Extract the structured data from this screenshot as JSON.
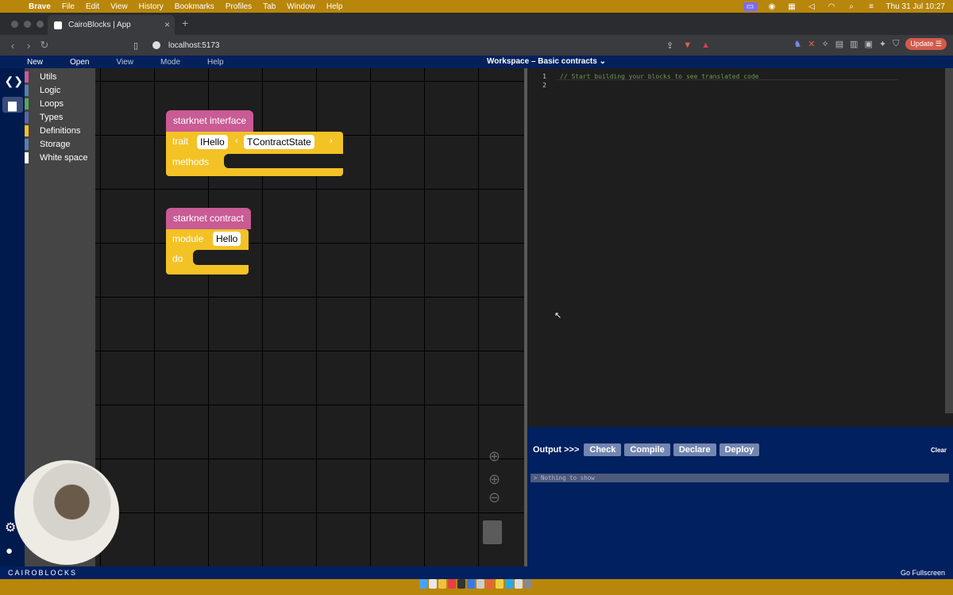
{
  "os_menubar": {
    "app_name": "Brave",
    "items": [
      "File",
      "Edit",
      "View",
      "History",
      "Bookmarks",
      "Profiles",
      "Tab",
      "Window",
      "Help"
    ],
    "datetime": "Thu 31 Jul  10:27"
  },
  "browser": {
    "tab_title": "CairoBlocks | App",
    "url": "localhost:5173",
    "update_label": "Update"
  },
  "app": {
    "menu": [
      "New",
      "Open",
      "View",
      "Mode",
      "Help"
    ],
    "workspace_title": "Workspace – Basic contracts",
    "categories": [
      {
        "label": "Utils",
        "color": "#c95b95"
      },
      {
        "label": "Logic",
        "color": "#5b80a5"
      },
      {
        "label": "Loops",
        "color": "#5ba55b"
      },
      {
        "label": "Types",
        "color": "#5b67a5"
      },
      {
        "label": "Definitions",
        "color": "#f3c225"
      },
      {
        "label": "Storage",
        "color": "#5b80a5"
      },
      {
        "label": "White space",
        "color": "#ffffff"
      }
    ],
    "blocks": {
      "interface": {
        "hat": "starknet interface",
        "trait_label": "trait",
        "trait_name": "IHello",
        "generic": "TContractState",
        "methods_label": "methods"
      },
      "contract": {
        "hat": "starknet contract",
        "module_label": "module",
        "module_name": "Hello",
        "do_label": "do"
      }
    },
    "editor": {
      "lines": [
        "1",
        "2"
      ],
      "code_line_1": "// Start building your blocks to see translated code"
    },
    "output": {
      "label": "Output >>>",
      "buttons": [
        "Check",
        "Compile",
        "Declare",
        "Deploy"
      ],
      "clear_label": "Clear",
      "message": "> Nothing to show"
    },
    "footer": {
      "brand": "CAIROBLOCKS",
      "fullscreen": "Go Fullscreen"
    }
  }
}
